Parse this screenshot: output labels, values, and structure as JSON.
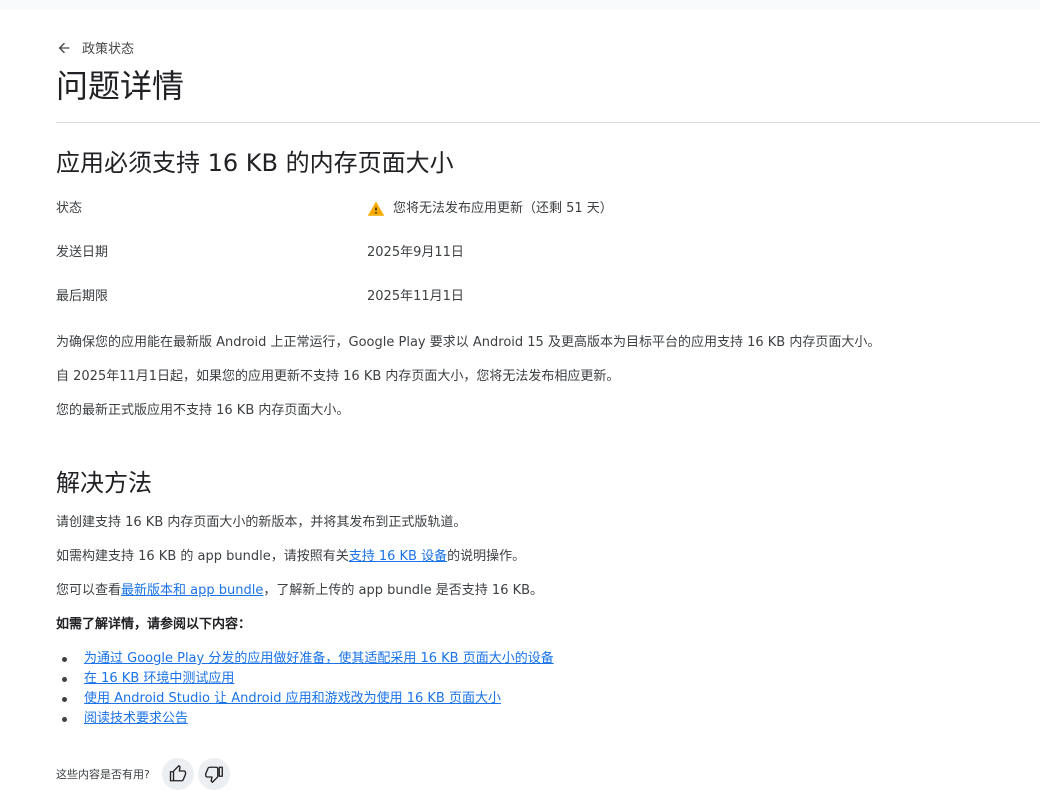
{
  "nav": {
    "back_label": "政策状态"
  },
  "page": {
    "title": "问题详情"
  },
  "issue": {
    "title": "应用必须支持 16 KB 的内存页面大小",
    "rows": [
      {
        "label": "状态",
        "value": "您将无法发布应用更新（还剩 51 天）"
      },
      {
        "label": "发送日期",
        "value": "2025年9月11日"
      },
      {
        "label": "最后期限",
        "value": "2025年11月1日"
      }
    ],
    "paragraphs": [
      "为确保您的应用能在最新版 Android 上正常运行，Google Play 要求以 Android 15 及更高版本为目标平台的应用支持 16 KB 内存页面大小。",
      "自 2025年11月1日起，如果您的应用更新不支持 16 KB 内存页面大小，您将无法发布相应更新。",
      "您的最新正式版应用不支持 16 KB 内存页面大小。"
    ]
  },
  "solution": {
    "title": "解决方法",
    "p1": "请创建支持 16 KB 内存页面大小的新版本，并将其发布到正式版轨道。",
    "p2_before": "如需构建支持 16 KB 的 app bundle，请按照有关",
    "p2_link": "支持 16 KB 设备",
    "p2_after": "的说明操作。",
    "p3_before": "您可以查看",
    "p3_link": "最新版本和 app bundle",
    "p3_after": "，了解新上传的 app bundle 是否支持 16 KB。",
    "more_label": "如需了解详情，请参阅以下内容：",
    "links": [
      "为通过 Google Play 分发的应用做好准备，使其适配采用 16 KB 页面大小的设备",
      "在 16 KB 环境中测试应用",
      "使用 Android Studio 让 Android 应用和游戏改为使用 16 KB 页面大小",
      "阅读技术要求公告"
    ]
  },
  "feedback": {
    "question": "这些内容是否有用?"
  },
  "colors": {
    "link": "#1a73e8",
    "warning": "#f9ab00",
    "divider": "#dadce0"
  },
  "icons": [
    "arrow-back-icon",
    "warning-icon",
    "thumb-up-icon",
    "thumb-down-icon"
  ]
}
